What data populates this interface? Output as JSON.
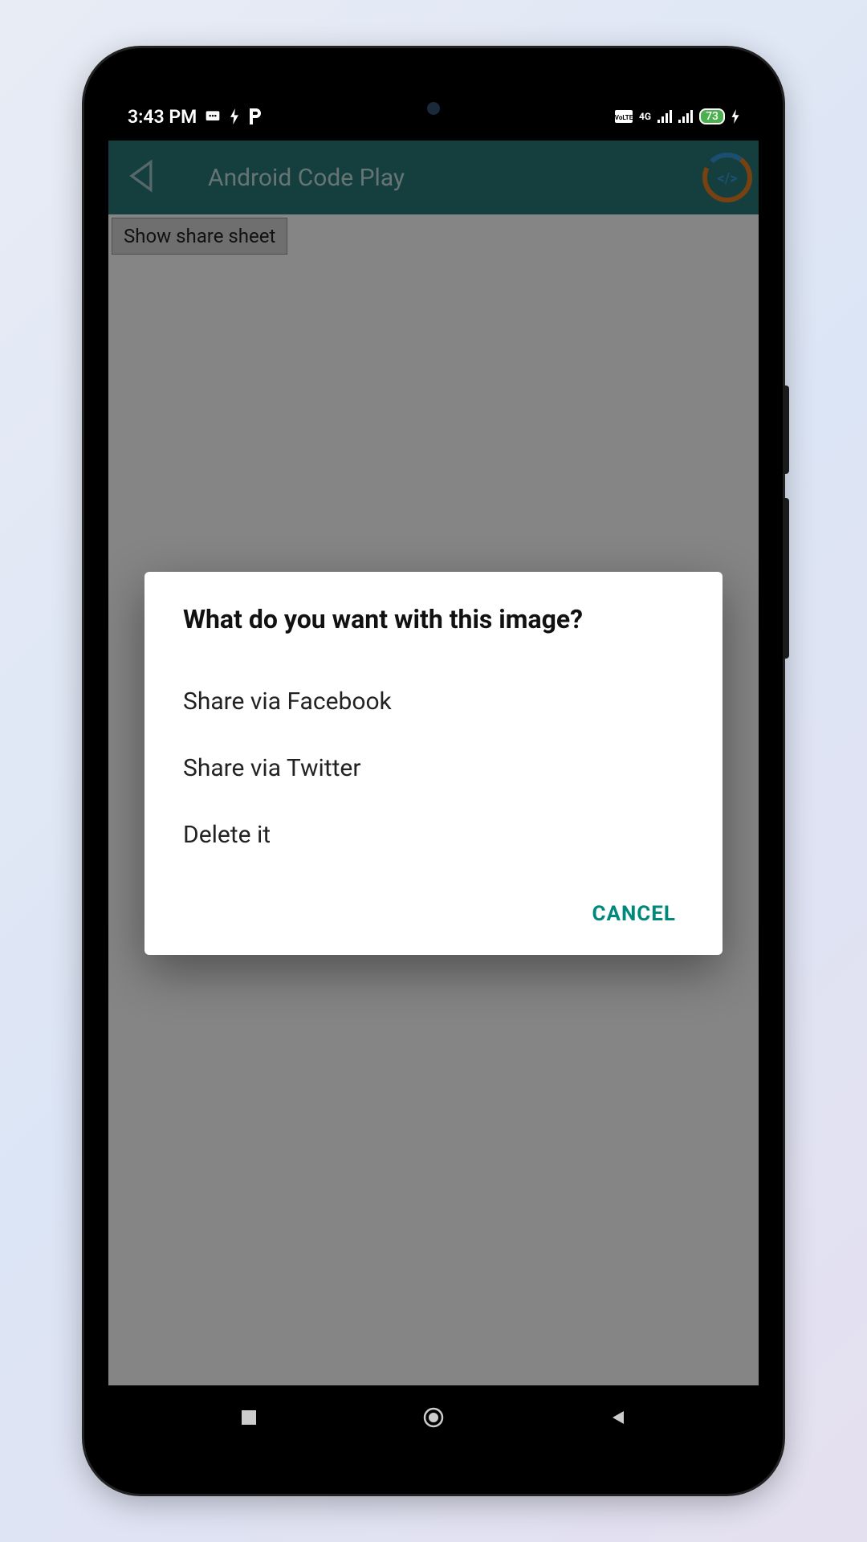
{
  "status": {
    "time": "3:43 PM",
    "battery_level": "73"
  },
  "appbar": {
    "title": "Android Code Play"
  },
  "content": {
    "share_button_label": "Show share sheet"
  },
  "dialog": {
    "title": "What do you want with this image?",
    "options": {
      "0": "Share via Facebook",
      "1": "Share via Twitter",
      "2": "Delete it"
    },
    "cancel_label": "CANCEL"
  }
}
